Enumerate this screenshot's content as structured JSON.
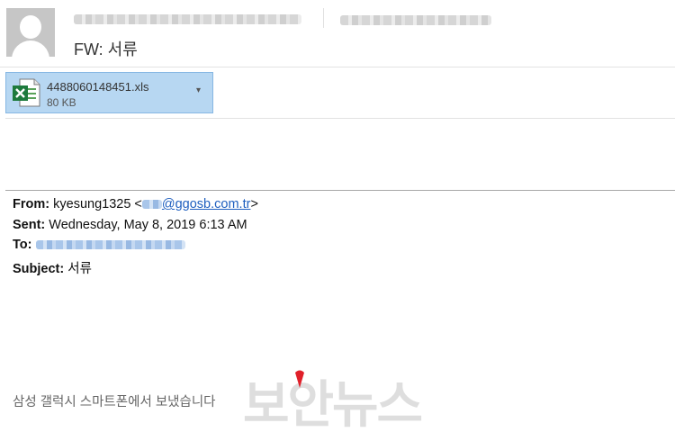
{
  "header": {
    "subject": "FW: 서류"
  },
  "attachment": {
    "filename": "4488060148451.xls",
    "size": "80 KB",
    "icon": "excel-file-icon",
    "dropdown_icon": "chevron-down-icon"
  },
  "message": {
    "from_label": "From:",
    "from_name": "kyesung1325 <",
    "from_email_domain": "@ggosb.com.tr",
    "from_close": ">",
    "sent_label": "Sent:",
    "sent_value": "Wednesday, May 8, 2019 6:13 AM",
    "to_label": "To:",
    "subject_label": "Subject:",
    "subject_value": "서류",
    "signature": "삼성 갤럭시 스마트폰에서 보냈습니다"
  },
  "watermark": {
    "text": "보안뉴스"
  },
  "colors": {
    "attachment_bg": "#b7d7f2",
    "link": "#1f5fbf",
    "watermark_dot": "#e0202a"
  }
}
